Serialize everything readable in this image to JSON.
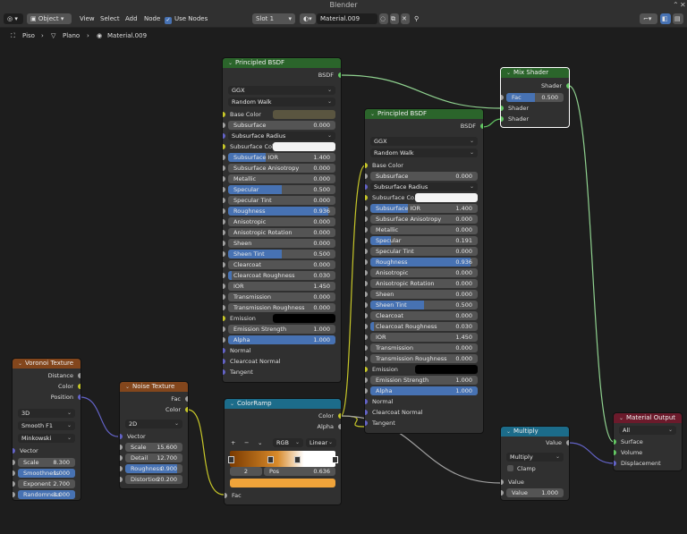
{
  "window": {
    "title": "Blender"
  },
  "header": {
    "mode": "Object",
    "menus": [
      "View",
      "Select",
      "Add",
      "Node"
    ],
    "use_nodes_label": "Use Nodes",
    "slot": "Slot 1",
    "material": "Material.009"
  },
  "breadcrumb": [
    "Piso",
    "Plano",
    "Material.009"
  ],
  "colors": {
    "shader": "#2b652b",
    "texture": "#83461c",
    "converter": "#1c6c8a",
    "output": "#6b1a2b",
    "field_blue": "#4772b3"
  },
  "voronoi": {
    "title": "Voronoi Texture",
    "outputs": [
      "Distance",
      "Color",
      "Position"
    ],
    "dims": "3D",
    "feature": "Smooth F1",
    "metric": "Minkowski",
    "vector": "Vector",
    "fields": [
      {
        "label": "Scale",
        "value": "8.300",
        "fill": 0
      },
      {
        "label": "Smoothness",
        "value": "1.000",
        "fill": 1
      },
      {
        "label": "Exponent",
        "value": "2.700",
        "fill": 0
      },
      {
        "label": "Randomness",
        "value": "1.000",
        "fill": 1
      }
    ]
  },
  "noise": {
    "title": "Noise Texture",
    "outputs": [
      "Fac",
      "Color"
    ],
    "dims": "2D",
    "vector": "Vector",
    "fields": [
      {
        "label": "Scale",
        "value": "15.600",
        "fill": 0
      },
      {
        "label": "Detail",
        "value": "12.700",
        "fill": 0
      },
      {
        "label": "Roughness",
        "value": "0.900",
        "fill": 0.9
      },
      {
        "label": "Distortion",
        "value": "20.200",
        "fill": 0
      }
    ]
  },
  "bsdf1": {
    "title": "Principled BSDF",
    "output": "BSDF",
    "distribution": "GGX",
    "subsurface_method": "Random Walk",
    "base_color": "Base Color",
    "subsurface": {
      "label": "Subsurface",
      "value": "0.000"
    },
    "subsurface_radius": "Subsurface Radius",
    "subsurface_col": "Subsurface Col",
    "fields": [
      {
        "label": "Subsurface IOR",
        "value": "1.400",
        "fill": 0.35
      },
      {
        "label": "Subsurface Anisotropy",
        "value": "0.000",
        "fill": 0
      },
      {
        "label": "Metallic",
        "value": "0.000",
        "fill": 0
      },
      {
        "label": "Specular",
        "value": "0.500",
        "fill": 0.5
      },
      {
        "label": "Specular Tint",
        "value": "0.000",
        "fill": 0
      },
      {
        "label": "Roughness",
        "value": "0.936",
        "fill": 0.936
      },
      {
        "label": "Anisotropic",
        "value": "0.000",
        "fill": 0
      },
      {
        "label": "Anisotropic Rotation",
        "value": "0.000",
        "fill": 0
      },
      {
        "label": "Sheen",
        "value": "0.000",
        "fill": 0
      },
      {
        "label": "Sheen Tint",
        "value": "0.500",
        "fill": 0.5
      },
      {
        "label": "Clearcoat",
        "value": "0.000",
        "fill": 0
      },
      {
        "label": "Clearcoat Roughness",
        "value": "0.030",
        "fill": 0.03
      },
      {
        "label": "IOR",
        "value": "1.450",
        "fill": 0
      },
      {
        "label": "Transmission",
        "value": "0.000",
        "fill": 0
      },
      {
        "label": "Transmission Roughness",
        "value": "0.000",
        "fill": 0
      }
    ],
    "emission": "Emission",
    "emission_strength": {
      "label": "Emission Strength",
      "value": "1.000"
    },
    "alpha": {
      "label": "Alpha",
      "value": "1.000"
    },
    "tail": [
      "Normal",
      "Clearcoat Normal",
      "Tangent"
    ]
  },
  "bsdf2": {
    "title": "Principled BSDF",
    "output": "BSDF",
    "distribution": "GGX",
    "subsurface_method": "Random Walk",
    "base_color": "Base Color",
    "subsurface": {
      "label": "Subsurface",
      "value": "0.000"
    },
    "subsurface_radius": "Subsurface Radius",
    "subsurface_col": "Subsurface Co...",
    "fields": [
      {
        "label": "Subsurface IOR",
        "value": "1.400",
        "fill": 0.35
      },
      {
        "label": "Subsurface Anisotropy",
        "value": "0.000",
        "fill": 0
      },
      {
        "label": "Metallic",
        "value": "0.000",
        "fill": 0
      },
      {
        "label": "Specular",
        "value": "0.191",
        "fill": 0.191
      },
      {
        "label": "Specular Tint",
        "value": "0.000",
        "fill": 0
      },
      {
        "label": "Roughness",
        "value": "0.936",
        "fill": 0.936
      },
      {
        "label": "Anisotropic",
        "value": "0.000",
        "fill": 0
      },
      {
        "label": "Anisotropic Rotation",
        "value": "0.000",
        "fill": 0
      },
      {
        "label": "Sheen",
        "value": "0.000",
        "fill": 0
      },
      {
        "label": "Sheen Tint",
        "value": "0.500",
        "fill": 0.5
      },
      {
        "label": "Clearcoat",
        "value": "0.000",
        "fill": 0
      },
      {
        "label": "Clearcoat Roughness",
        "value": "0.030",
        "fill": 0.03
      },
      {
        "label": "IOR",
        "value": "1.450",
        "fill": 0
      },
      {
        "label": "Transmission",
        "value": "0.000",
        "fill": 0
      },
      {
        "label": "Transmission Roughness",
        "value": "0.000",
        "fill": 0
      }
    ],
    "emission": "Emission",
    "emission_strength": {
      "label": "Emission Strength",
      "value": "1.000"
    },
    "alpha": {
      "label": "Alpha",
      "value": "1.000"
    },
    "tail": [
      "Normal",
      "Clearcoat Normal",
      "Tangent"
    ]
  },
  "colorramp": {
    "title": "ColorRamp",
    "outputs": [
      "Color",
      "Alpha"
    ],
    "mode": "RGB",
    "interpolation": "Linear",
    "index": "2",
    "pos_label": "Pos",
    "pos_value": "0.636",
    "input": "Fac"
  },
  "mix": {
    "title": "Mix Shader",
    "output": "Shader",
    "fac_label": "Fac",
    "fac_value": "0.500",
    "inputs": [
      "Shader",
      "Shader"
    ]
  },
  "multiply": {
    "title": "Multiply",
    "output": "Value",
    "operation": "Multiply",
    "clamp": "Clamp",
    "input": "Value",
    "value_label": "Value",
    "value_value": "1.000"
  },
  "output": {
    "title": "Material Output",
    "target": "All",
    "inputs": [
      "Surface",
      "Volume",
      "Displacement"
    ]
  }
}
